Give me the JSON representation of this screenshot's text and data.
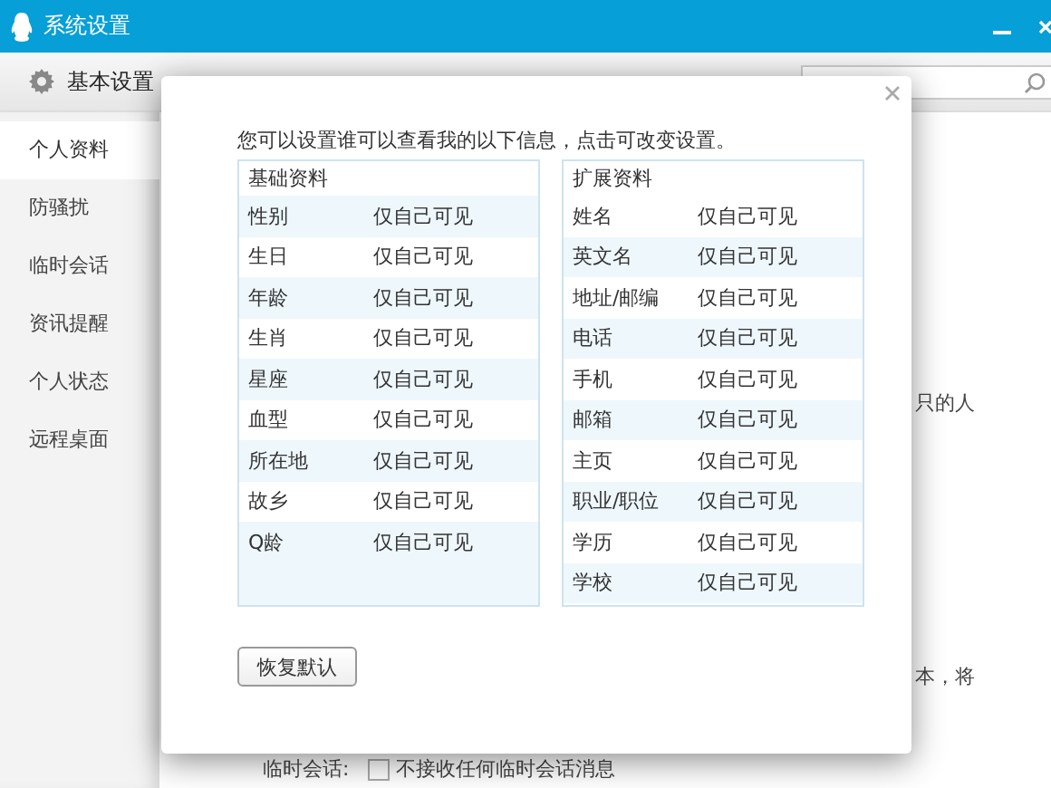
{
  "window": {
    "title": "系统设置"
  },
  "toolbar": {
    "tabs": [
      {
        "label": "基本设置",
        "selected": true
      }
    ]
  },
  "sidebar": {
    "items": [
      {
        "label": "个人资料",
        "selected": true
      },
      {
        "label": "防骚扰",
        "selected": false
      },
      {
        "label": "临时会话",
        "selected": false
      },
      {
        "label": "资讯提醒",
        "selected": false
      },
      {
        "label": "个人状态",
        "selected": false
      },
      {
        "label": "远程桌面",
        "selected": false
      }
    ]
  },
  "background": {
    "text_1": "只的人",
    "text_2": "本，将",
    "temp_chat": {
      "label": "临时会话:",
      "checkbox": {
        "label": "不接收任何临时会话消息",
        "checked": false
      }
    }
  },
  "dialog": {
    "intro": "您可以设置谁可以查看我的以下信息，点击可改变设置。",
    "tables": [
      {
        "title": "基础资料",
        "rows": [
          {
            "field": "性别",
            "visibility": "仅自己可见"
          },
          {
            "field": "生日",
            "visibility": "仅自己可见"
          },
          {
            "field": "年龄",
            "visibility": "仅自己可见"
          },
          {
            "field": "生肖",
            "visibility": "仅自己可见"
          },
          {
            "field": "星座",
            "visibility": "仅自己可见"
          },
          {
            "field": "血型",
            "visibility": "仅自己可见"
          },
          {
            "field": "所在地",
            "visibility": "仅自己可见"
          },
          {
            "field": "故乡",
            "visibility": "仅自己可见"
          },
          {
            "field": "Q龄",
            "visibility": "仅自己可见"
          }
        ]
      },
      {
        "title": "扩展资料",
        "rows": [
          {
            "field": "姓名",
            "visibility": "仅自己可见"
          },
          {
            "field": "英文名",
            "visibility": "仅自己可见"
          },
          {
            "field": "地址/邮编",
            "visibility": "仅自己可见"
          },
          {
            "field": "电话",
            "visibility": "仅自己可见"
          },
          {
            "field": "手机",
            "visibility": "仅自己可见"
          },
          {
            "field": "邮箱",
            "visibility": "仅自己可见"
          },
          {
            "field": "主页",
            "visibility": "仅自己可见"
          },
          {
            "field": "职业/职位",
            "visibility": "仅自己可见"
          },
          {
            "field": "学历",
            "visibility": "仅自己可见"
          },
          {
            "field": "学校",
            "visibility": "仅自己可见"
          }
        ]
      }
    ],
    "button": "恢复默认"
  }
}
